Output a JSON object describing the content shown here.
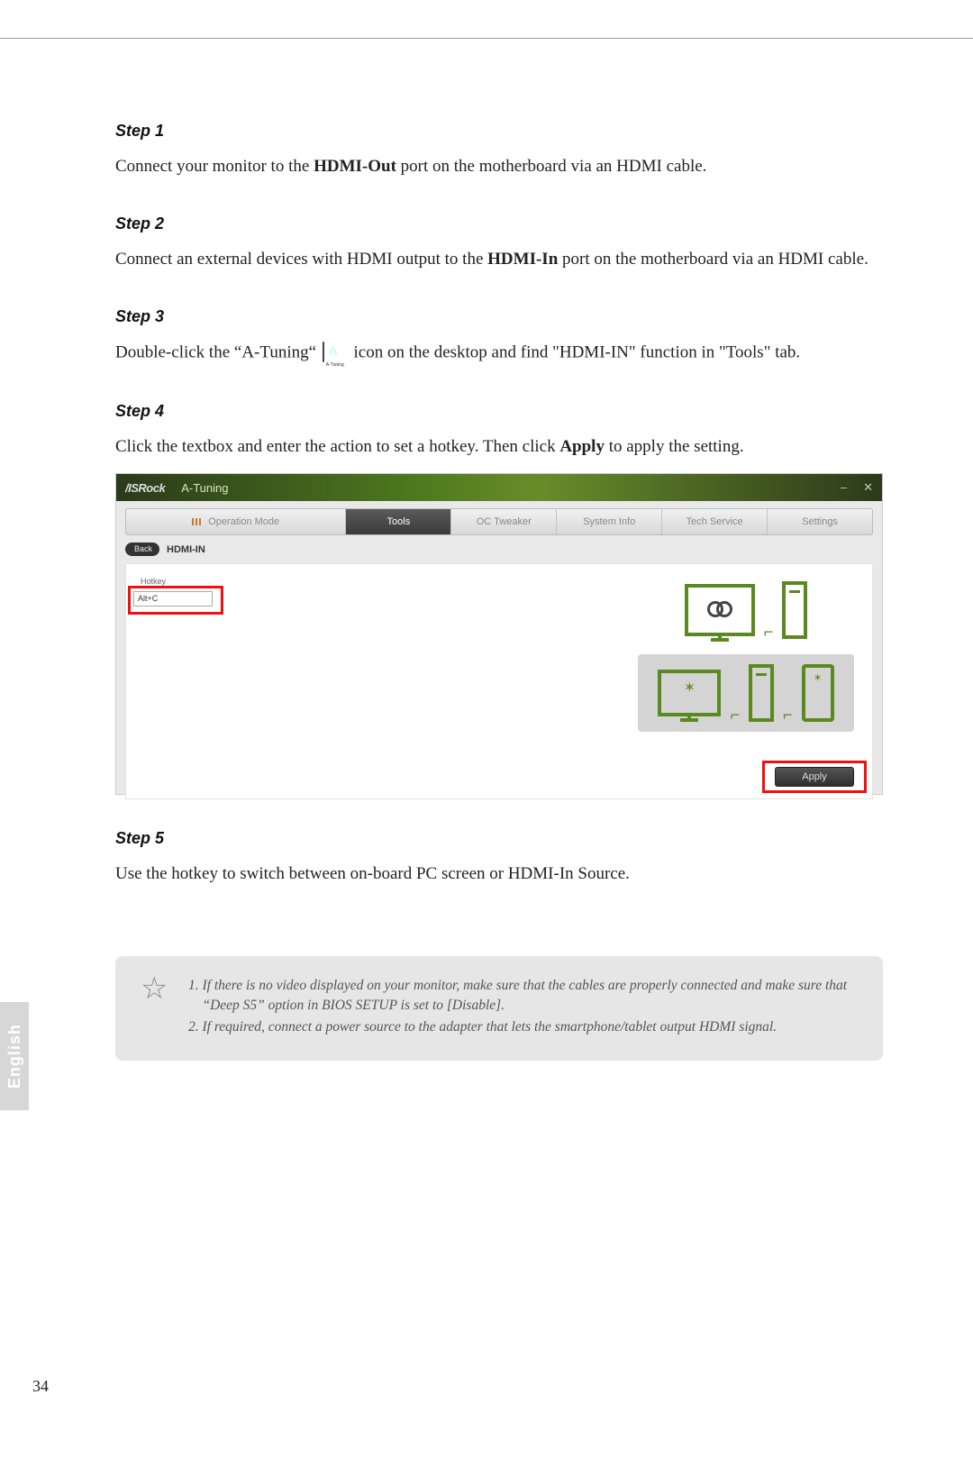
{
  "language_tab": "English",
  "page_number": "34",
  "steps": {
    "s1_title": "Step 1",
    "s1_body_pre": "Connect your monitor to the ",
    "s1_body_bold": "HDMI-Out",
    "s1_body_post": " port on the motherboard via an HDMI cable.",
    "s2_title": "Step 2",
    "s2_body_pre": "Connect an external devices with HDMI output to the ",
    "s2_body_bold": "HDMI-In",
    "s2_body_post": " port on the motherboard via an HDMI cable.",
    "s3_title": "Step 3",
    "s3_body_pre": "Double-click the “A-Tuning“ ",
    "s3_body_post": " icon on the desktop and find \"HDMI-IN\" function in \"Tools\" tab.",
    "s3_icon_caption": "A-Tuning",
    "s4_title": "Step 4",
    "s4_body_pre": "Click the textbox and enter the action to set a hotkey. Then click ",
    "s4_body_bold": "Apply",
    "s4_body_post": " to apply the setting.",
    "s5_title": "Step 5",
    "s5_body": "Use the hotkey to switch between on-board PC screen or HDMI-In Source."
  },
  "app": {
    "brand": "/ISRock",
    "title": "A-Tuning",
    "win_min": "–",
    "win_close": "✕",
    "tabs": {
      "op": "Operation Mode",
      "tools": "Tools",
      "oc": "OC Tweaker",
      "sys": "System Info",
      "tech": "Tech Service",
      "set": "Settings"
    },
    "back": "Back",
    "section": "HDMI-IN",
    "hotkey_label": "Hotkey",
    "hotkey_value": "Alt+C",
    "apply": "Apply"
  },
  "notes": {
    "n1": "If there is no video displayed on your monitor, make sure that the cables are properly connected and make sure that “Deep S5” option in BIOS SETUP is set to [Disable].",
    "n2": "If required, connect a power source to the adapter that lets the smartphone/tablet output HDMI signal."
  }
}
